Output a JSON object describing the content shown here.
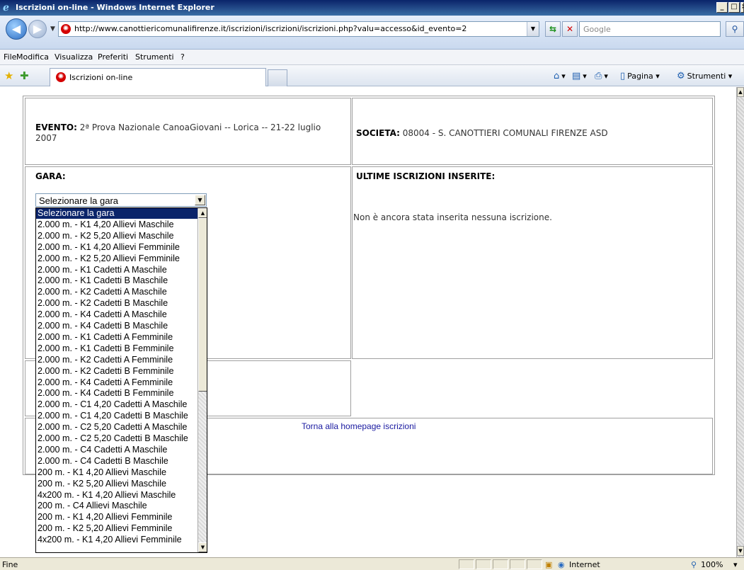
{
  "window": {
    "title": "Iscrizioni on-line - Windows Internet Explorer"
  },
  "address": {
    "url": "http://www.canottiericomunalifirenze.it/iscrizioni/iscrizioni/iscrizioni.php?valu=accesso&id_evento=2",
    "search_placeholder": "Google"
  },
  "menu": [
    "File",
    "Modifica",
    "Visualizza",
    "Preferiti",
    "Strumenti",
    "?"
  ],
  "tab": {
    "label": "Iscrizioni on-line"
  },
  "commands": {
    "page": "Pagina",
    "tools": "Strumenti"
  },
  "form": {
    "evento_label": "EVENTO:",
    "evento_value": "2ª Prova Nazionale CanoaGiovani -- Lorica -- 21-22 luglio 2007",
    "societa_label": "SOCIETA:",
    "societa_value": "08004 - S. CANOTTIERI COMUNALI FIRENZE ASD",
    "gara_label": "GARA:",
    "ultime_label": "ULTIME ISCRIZIONI INSERITE:",
    "ultime_empty": "Non è ancora stata inserita nessuna iscrizione.",
    "home_link": "Torna alla homepage iscrizioni"
  },
  "gara_select": {
    "selected": "Selezionare la gara",
    "options": [
      "Selezionare la gara",
      "2.000 m. - K1 4,20 Allievi Maschile",
      "2.000 m. - K2 5,20 Allievi Maschile",
      "2.000 m. - K1 4,20 Allievi Femminile",
      "2.000 m. - K2 5,20 Allievi Femminile",
      "2.000 m. - K1 Cadetti A Maschile",
      "2.000 m. - K1 Cadetti B Maschile",
      "2.000 m. - K2 Cadetti A Maschile",
      "2.000 m. - K2 Cadetti B Maschile",
      "2.000 m. - K4 Cadetti A Maschile",
      "2.000 m. - K4 Cadetti B Maschile",
      "2.000 m. - K1 Cadetti A Femminile",
      "2.000 m. - K1 Cadetti B Femminile",
      "2.000 m. - K2 Cadetti A Femminile",
      "2.000 m. - K2 Cadetti B Femminile",
      "2.000 m. - K4 Cadetti A Femminile",
      "2.000 m. - K4 Cadetti B Femminile",
      "2.000 m. - C1 4,20 Cadetti A Maschile",
      "2.000 m. - C1 4,20 Cadetti B Maschile",
      "2.000 m. - C2 5,20 Cadetti A Maschile",
      "2.000 m. - C2 5,20 Cadetti B Maschile",
      "2.000 m. - C4 Cadetti A Maschile",
      "2.000 m. - C4 Cadetti B Maschile",
      "200 m. - K1 4,20 Allievi Maschile",
      "200 m. - K2 5,20 Allievi Maschile",
      "4x200 m. - K1 4,20 Allievi Maschile",
      "200 m. - C4 Allievi Maschile",
      "200 m. - K1 4,20 Allievi Femminile",
      "200 m. - K2 5,20 Allievi Femminile",
      "4x200 m. - K1 4,20 Allievi Femminile"
    ]
  },
  "status": {
    "left": "Fine",
    "zone": "Internet",
    "zoom": "100%"
  }
}
